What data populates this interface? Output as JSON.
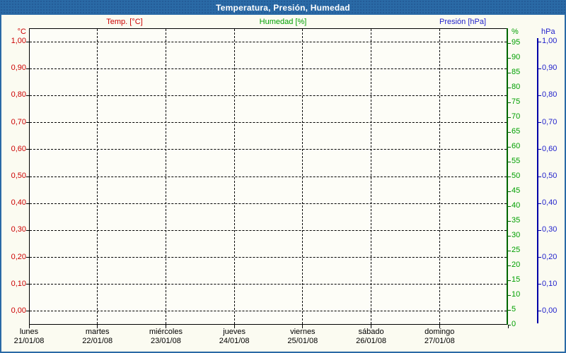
{
  "title_bar": {
    "text": "Temperatura, Presión, Humedad",
    "background": "#2a6aa6",
    "text_color": "#ffffff"
  },
  "window": {
    "border_color": "#2a6aa6",
    "background": "#fbfbf1",
    "plot_background": "#fdfdf7"
  },
  "legend": [
    {
      "label": "Temp. [°C]",
      "color": "#cc0000"
    },
    {
      "label": "Humedad [%]",
      "color": "#00a000"
    },
    {
      "label": "Presión [hPa]",
      "color": "#2222cc"
    }
  ],
  "chart_data": {
    "type": "line",
    "title": "Temperatura, Presión, Humedad",
    "grid": {
      "horizontal": "dashed",
      "vertical": "dashed"
    },
    "x_axis": {
      "days": [
        {
          "name": "lunes",
          "date": "21/01/08"
        },
        {
          "name": "martes",
          "date": "22/01/08"
        },
        {
          "name": "miércoles",
          "date": "23/01/08"
        },
        {
          "name": "jueves",
          "date": "24/01/08"
        },
        {
          "name": "viernes",
          "date": "25/01/08"
        },
        {
          "name": "sábado",
          "date": "26/01/08"
        },
        {
          "name": "domingo",
          "date": "27/01/08"
        }
      ]
    },
    "axes": {
      "temperature": {
        "title": "°C",
        "side": "left",
        "label_color": "#cc0000",
        "ylim": [
          -0.05,
          1.05
        ],
        "tick_values": [
          0,
          0.1,
          0.2,
          0.3,
          0.4,
          0.5,
          0.6,
          0.7,
          0.8,
          0.9,
          1.0
        ],
        "tick_labels": [
          "0,00",
          "0,10",
          "0,20",
          "0,30",
          "0,40",
          "0,50",
          "0,60",
          "0,70",
          "0,80",
          "0,90",
          "1,00"
        ]
      },
      "humidity": {
        "title": "%",
        "side": "right",
        "label_color": "#00a000",
        "line_color": "#006600",
        "ylim": [
          0,
          100
        ],
        "tick_values": [
          0,
          5,
          10,
          15,
          20,
          25,
          30,
          35,
          40,
          45,
          50,
          55,
          60,
          65,
          70,
          75,
          80,
          85,
          90,
          95
        ],
        "tick_labels": [
          "0",
          "5",
          "10",
          "15",
          "20",
          "25",
          "30",
          "35",
          "40",
          "45",
          "50",
          "55",
          "60",
          "65",
          "70",
          "75",
          "80",
          "85",
          "90",
          "95"
        ]
      },
      "pressure": {
        "title": "hPa",
        "side": "far_right",
        "label_color": "#2222cc",
        "line_color": "#0000a8",
        "ylim": [
          -0.05,
          1.05
        ],
        "tick_values": [
          0,
          0.1,
          0.2,
          0.3,
          0.4,
          0.5,
          0.6,
          0.7,
          0.8,
          0.9,
          1.0
        ],
        "tick_labels": [
          "0,00",
          "0,10",
          "0,20",
          "0,30",
          "0,40",
          "0,50",
          "0,60",
          "0,70",
          "0,80",
          "0,90",
          "1,00"
        ]
      }
    },
    "series": [
      {
        "name": "Temp. [°C]",
        "axis": "temperature",
        "color": "#cc0000",
        "values": []
      },
      {
        "name": "Humedad [%]",
        "axis": "humidity",
        "color": "#00a000",
        "values": []
      },
      {
        "name": "Presión [hPa]",
        "axis": "pressure",
        "color": "#2222cc",
        "values": []
      }
    ]
  }
}
